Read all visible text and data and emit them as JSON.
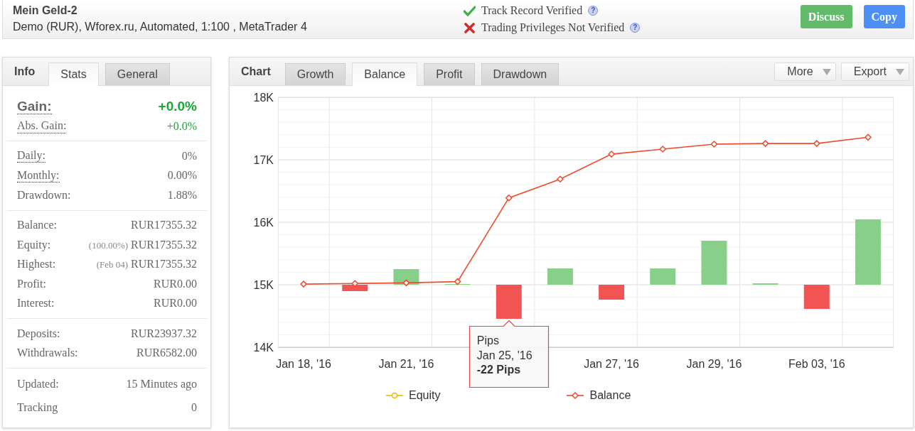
{
  "header": {
    "title": "Mein Geld-2",
    "subtitle": "Demo (RUR), Wforex.ru, Automated, 1:100 , MetaTrader 4",
    "verifications": [
      {
        "text": "Track Record Verified",
        "verified": true,
        "help": "?"
      },
      {
        "text": "Trading Privileges Not Verified",
        "verified": false,
        "help": "?"
      }
    ],
    "buttons": [
      {
        "label": "Discuss",
        "kind": "success"
      },
      {
        "label": "Copy",
        "kind": "primary"
      }
    ]
  },
  "info_panel": {
    "title": "Info",
    "tabs": [
      {
        "label": "Stats",
        "selected": true
      },
      {
        "label": "General",
        "selected": false
      }
    ],
    "groups": [
      {
        "rows": [
          {
            "label": "Gain:",
            "value": "+0.0%",
            "kind": "headline",
            "underlined": true
          },
          {
            "label": "Abs. Gain:",
            "value": "+0.0%",
            "kind": "gain",
            "underlined": true
          }
        ]
      },
      {
        "rows": [
          {
            "label": "Daily:",
            "value": "0%",
            "kind": "plain",
            "underlined": true
          },
          {
            "label": "Monthly:",
            "value": "0.00%",
            "kind": "plain",
            "underlined": true
          },
          {
            "label": "Drawdown:",
            "value": "1.88%",
            "kind": "plain",
            "underlined": false
          }
        ]
      },
      {
        "rows": [
          {
            "label": "Balance:",
            "value": "RUR17355.32",
            "kind": "plain",
            "underlined": false
          },
          {
            "label": "Equity:",
            "note": "(100.00%)",
            "value": "RUR17355.32",
            "kind": "plain",
            "underlined": false
          },
          {
            "label": "Highest:",
            "note": "(Feb 04)",
            "value": "RUR17355.32",
            "kind": "plain",
            "underlined": false
          },
          {
            "label": "Profit:",
            "value": "RUR0.00",
            "kind": "plain",
            "underlined": false
          },
          {
            "label": "Interest:",
            "value": "RUR0.00",
            "kind": "plain",
            "underlined": false
          }
        ]
      },
      {
        "rows": [
          {
            "label": "Deposits:",
            "value": "RUR23937.32",
            "kind": "plain",
            "underlined": false
          },
          {
            "label": "Withdrawals:",
            "value": "RUR6582.00",
            "kind": "plain",
            "underlined": false
          }
        ]
      },
      {
        "rows": [
          {
            "label": "Updated:",
            "value": "15 Minutes ago",
            "kind": "plain",
            "underlined": false
          },
          {
            "label": "Tracking",
            "value": "0",
            "kind": "plain",
            "underlined": false
          }
        ]
      }
    ]
  },
  "chart_panel": {
    "title": "Chart",
    "tabs": [
      {
        "label": "Growth",
        "selected": false
      },
      {
        "label": "Balance",
        "selected": true
      },
      {
        "label": "Profit",
        "selected": false
      },
      {
        "label": "Drawdown",
        "selected": false
      }
    ],
    "menus": [
      "More",
      "Export"
    ],
    "chart_data": {
      "type": "line",
      "grid": true,
      "categories": [
        "Jan 18, '16",
        null,
        "Jan 21, '16",
        null,
        null,
        null,
        "Jan 27, '16",
        null,
        "Jan 29, '16",
        null,
        "Feb 03, '16",
        null
      ],
      "ylim": [
        14000,
        18000
      ],
      "yticks": [
        {
          "value": 14000,
          "label": "14K"
        },
        {
          "value": 15000,
          "label": "15K"
        },
        {
          "value": 16000,
          "label": "16K"
        },
        {
          "value": 17000,
          "label": "17K"
        },
        {
          "value": 18000,
          "label": "18K"
        }
      ],
      "series": [
        {
          "name": "Equity",
          "marker": "circle",
          "color": "#f7b500",
          "values": [
            null,
            null,
            null,
            null,
            null,
            null,
            null,
            null,
            null,
            null,
            null,
            null
          ]
        },
        {
          "name": "Balance",
          "marker": "diamond",
          "color": "#ef4b2c",
          "values": [
            15010,
            15020,
            15030,
            15050,
            16390,
            16690,
            17090,
            17170,
            17250,
            17260,
            17260,
            17360
          ]
        }
      ]
    },
    "tooltip": {
      "title": "Pips",
      "date": "Jan 25, '16",
      "value": "-22 Pips"
    }
  }
}
